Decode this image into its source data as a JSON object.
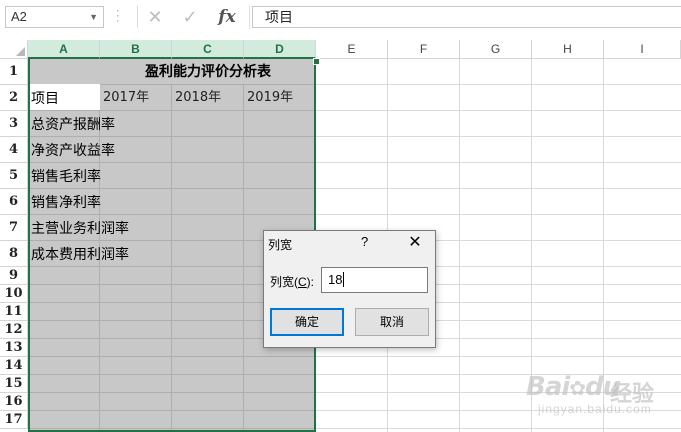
{
  "formula_bar": {
    "name_box": "A2",
    "cancel_glyph": "✕",
    "enter_glyph": "✓",
    "fx_label": "fx",
    "formula": "项目"
  },
  "columns": [
    "A",
    "B",
    "C",
    "D",
    "E",
    "F",
    "G",
    "H",
    "I"
  ],
  "rows": [
    "1",
    "2",
    "3",
    "4",
    "5",
    "6",
    "7",
    "8",
    "9",
    "10",
    "11",
    "12",
    "13",
    "14",
    "15",
    "16",
    "17"
  ],
  "sheet": {
    "title": "盈利能力评价分析表",
    "header_item": "项目",
    "years": [
      "2017年",
      "2018年",
      "2019年"
    ],
    "items": [
      "总资产报酬率",
      "净资产收益率",
      "销售毛利率",
      "销售净利率",
      "主营业务利润率",
      "成本费用利润率"
    ]
  },
  "dialog": {
    "title": "列宽",
    "help": "?",
    "close": "✕",
    "label_prefix": "列宽(",
    "label_key": "C",
    "label_suffix": "):",
    "value": "18",
    "ok_label": "确定",
    "cancel_label": "取消"
  },
  "watermark": {
    "brand": "Bai",
    "brand2": "du",
    "cn": "经验",
    "url": "jingyan.baidu.com"
  },
  "colors": {
    "accent": "#217346",
    "selection": "#c8c8c8",
    "header_selected": "#d3ebdc"
  }
}
